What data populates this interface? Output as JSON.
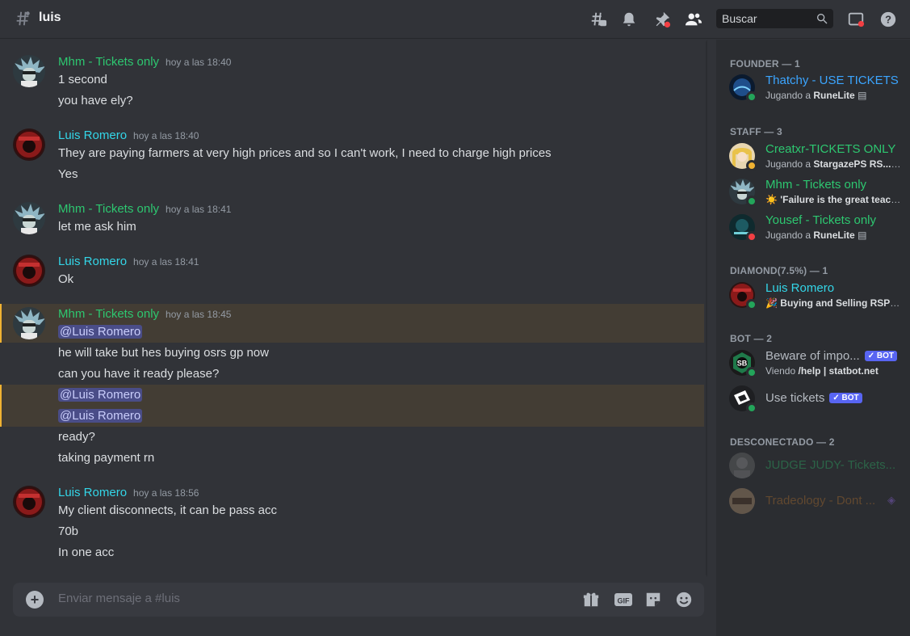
{
  "header": {
    "channel": "luis",
    "search_placeholder": "Buscar"
  },
  "messages": [
    {
      "author": "Mhm - Tickets only",
      "time": "hoy a las 18:40",
      "lines": [
        "1 second",
        "you have ely?"
      ]
    },
    {
      "author": "Luis Romero",
      "time": "hoy a las 18:40",
      "lines": [
        "They are paying farmers at very high prices and so I can't work, I need to charge high prices",
        "Yes"
      ]
    },
    {
      "author": "Mhm - Tickets only",
      "time": "hoy a las 18:41",
      "lines": [
        "let me ask him"
      ]
    },
    {
      "author": "Luis Romero",
      "time": "hoy a las 18:41",
      "lines": [
        "Ok"
      ]
    },
    {
      "author": "Mhm - Tickets only",
      "time": "hoy a las 18:45",
      "lines": [
        "@Luis Romero",
        "he will take but hes buying osrs gp now",
        "can you have it ready please?",
        "@Luis Romero",
        "@Luis Romero",
        "ready?",
        "taking payment rn"
      ]
    },
    {
      "author": "Luis Romero",
      "time": "hoy a las 18:56",
      "lines": [
        "My client disconnects, it can be pass acc",
        "70b",
        "In one acc"
      ]
    }
  ],
  "composer": {
    "placeholder": "Enviar mensaje a #luis",
    "gif_label": "GIF"
  },
  "members": {
    "sections": [
      {
        "title": "FOUNDER — 1"
      },
      {
        "title": "STAFF — 3"
      },
      {
        "title": "DIAMOND(7.5%) — 1"
      },
      {
        "title": "BOT — 2"
      },
      {
        "title": "DESCONECTADO — 2"
      }
    ],
    "list": [
      {
        "name": "Thatchy - USE TICKETS",
        "activity_prefix": "Jugando a ",
        "activity_bold": "RuneLite",
        "color": "#3ba5ff",
        "status": "online"
      },
      {
        "name": "Creatxr-TICKETS ONLY",
        "activity_prefix": "Jugando a ",
        "activity_bold": "StargazePS RS...",
        "color": "#2dc770",
        "status": "idle"
      },
      {
        "name": "Mhm - Tickets only",
        "activity_prefix": "☀️ ",
        "activity_bold": "'Failure is the great teache...",
        "color": "#2dc770",
        "status": "online"
      },
      {
        "name": "Yousef - Tickets only",
        "activity_prefix": "Jugando a ",
        "activity_bold": "RuneLite",
        "color": "#2dc770",
        "status": "dnd"
      },
      {
        "name": "Luis Romero",
        "activity_prefix": "🎉 ",
        "activity_bold": "Buying and Selling RSPS a...",
        "color": "#33d6e8",
        "status": "online"
      },
      {
        "name": "Beware of impo...",
        "activity_prefix": "Viendo ",
        "activity_bold": "/help | statbot.net",
        "color": "#b5bac1",
        "status": "online",
        "badge": "✓ BOT"
      },
      {
        "name": "Use tickets",
        "activity_prefix": "",
        "activity_bold": "",
        "color": "#b5bac1",
        "status": "online",
        "badge": "✓ BOT"
      },
      {
        "name": "JUDGE JUDY- Tickets...",
        "color": "#2dc770",
        "status": "offline"
      },
      {
        "name": "Tradeology - Dont ...",
        "color": "#c77a2d",
        "status": "offline"
      }
    ]
  },
  "icons": [
    "hashtag-icon",
    "threads-icon",
    "bell-icon",
    "pin-icon",
    "members-icon",
    "search-icon",
    "inbox-icon",
    "help-icon",
    "plus-icon",
    "gift-icon",
    "gif-icon",
    "sticker-icon",
    "emoji-icon"
  ]
}
